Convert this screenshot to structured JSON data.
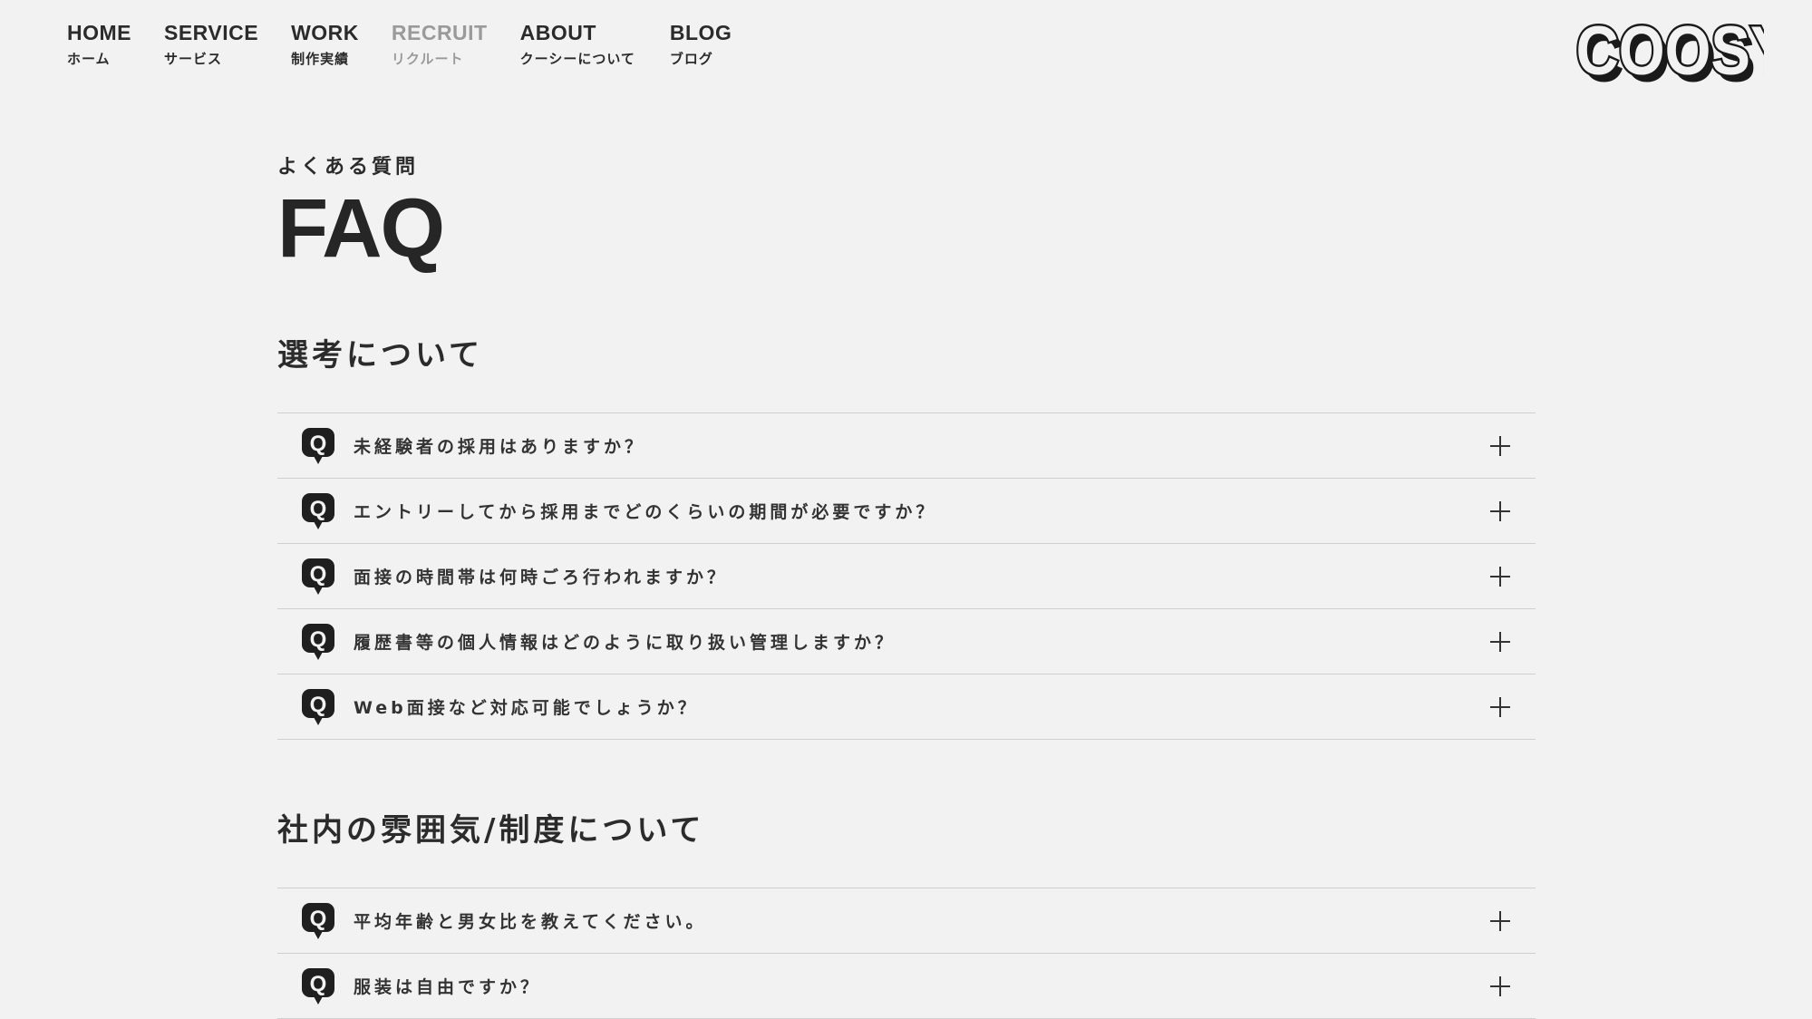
{
  "nav": {
    "items": [
      {
        "en": "HOME",
        "ja": "ホーム"
      },
      {
        "en": "SERVICE",
        "ja": "サービス"
      },
      {
        "en": "WORK",
        "ja": "制作実績"
      },
      {
        "en": "RECRUIT",
        "ja": "リクルート"
      },
      {
        "en": "ABOUT",
        "ja": "クーシーについて"
      },
      {
        "en": "BLOG",
        "ja": "ブログ"
      }
    ],
    "active_index": 3
  },
  "logo": {
    "text": "COOSY"
  },
  "page": {
    "eyebrow": "よくある質問",
    "title": "FAQ"
  },
  "sections": [
    {
      "title": "選考について",
      "questions": [
        "未経験者の採用はありますか？",
        "エントリーしてから採用までどのくらいの期間が必要ですか？",
        "面接の時間帯は何時ごろ行われますか？",
        "履歴書等の個人情報はどのように取り扱い管理しますか？",
        "Web面接など対応可能でしょうか？"
      ]
    },
    {
      "title": "社内の雰囲気/制度について",
      "questions": [
        "平均年齢と男女比を教えてください。",
        "服装は自由ですか？"
      ]
    }
  ],
  "icons": {
    "question": "q-bubble-icon",
    "expand": "plus-icon"
  },
  "colors": {
    "background": "#f2f2f2",
    "text": "#2b2b2b",
    "active_nav": "#9a9a9a",
    "divider": "#cfcfcf"
  }
}
